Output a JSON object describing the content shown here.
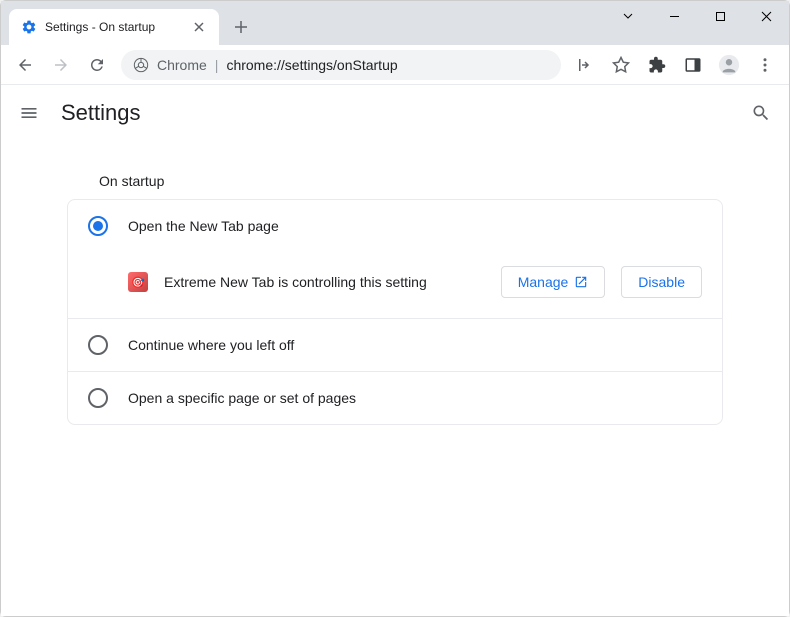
{
  "tab": {
    "title": "Settings - On startup"
  },
  "addressbar": {
    "context": "Chrome",
    "url": "chrome://settings/onStartup"
  },
  "header": {
    "title": "Settings"
  },
  "section": {
    "title": "On startup"
  },
  "options": {
    "new_tab": "Open the New Tab page",
    "continue": "Continue where you left off",
    "specific": "Open a specific page or set of pages"
  },
  "extension": {
    "message": "Extreme New Tab is controlling this setting",
    "manage": "Manage",
    "disable": "Disable"
  }
}
